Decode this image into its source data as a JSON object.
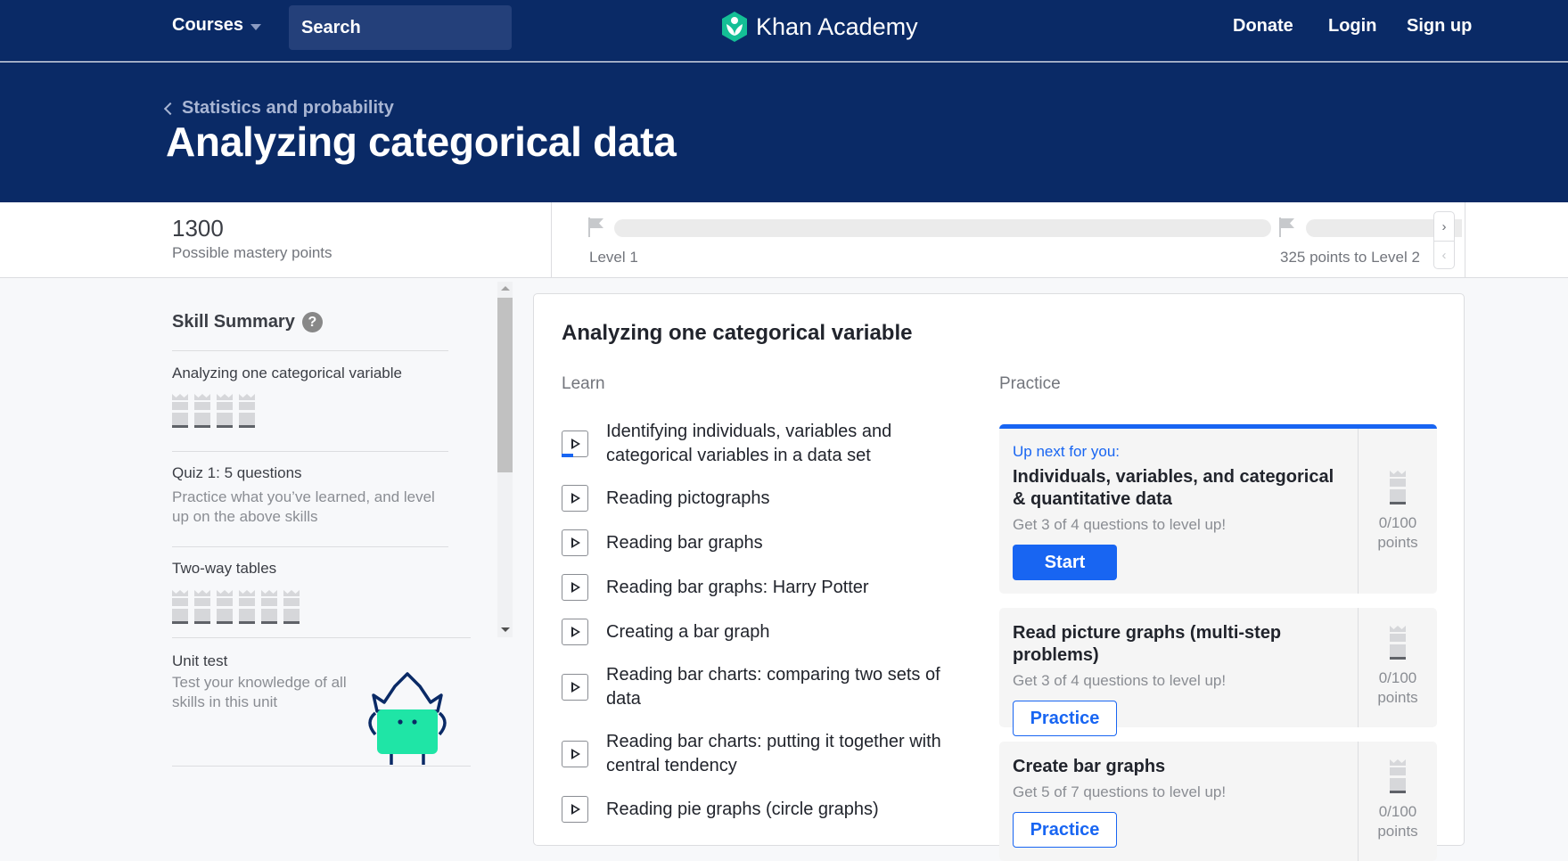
{
  "nav": {
    "courses_label": "Courses",
    "search_placeholder": "Search",
    "logo_text": "Khan Academy",
    "donate": "Donate",
    "login": "Login",
    "signup": "Sign up"
  },
  "hero": {
    "breadcrumb": "Statistics and probability",
    "title": "Analyzing categorical data"
  },
  "stats": {
    "mastery_points": "1300",
    "mastery_label": "Possible mastery points",
    "level_current": "Level 1",
    "level_next_text": "325 points to Level 2",
    "progress_fraction": 0
  },
  "sidebar": {
    "title": "Skill Summary",
    "help_glyph": "?",
    "items": [
      {
        "label": "Analyzing one categorical variable",
        "towers": 4
      },
      {
        "label": "Quiz 1: 5 questions",
        "desc": "Practice what you’ve learned, and level up on the above skills"
      },
      {
        "label": "Two-way tables",
        "towers": 6
      }
    ],
    "unit_test": {
      "title": "Unit test",
      "desc": "Test your knowledge of all skills in this unit"
    }
  },
  "main": {
    "section_title": "Analyzing one categorical variable",
    "learn_label": "Learn",
    "practice_label": "Practice",
    "lessons": [
      {
        "title": "Identifying individuals, variables and categorical variables in a data set",
        "in_progress": true
      },
      {
        "title": "Reading pictographs"
      },
      {
        "title": "Reading bar graphs"
      },
      {
        "title": "Reading bar graphs: Harry Potter"
      },
      {
        "title": "Creating a bar graph"
      },
      {
        "title": "Reading bar charts: comparing two sets of data"
      },
      {
        "title": "Reading bar charts: putting it together with central tendency"
      },
      {
        "title": "Reading pie graphs (circle graphs)"
      }
    ],
    "practice": [
      {
        "upnext": "Up next for you:",
        "title": "Individuals, variables, and categorical & quantitative data",
        "sub": "Get 3 of 4 questions to level up!",
        "button": "Start",
        "points": "0/100",
        "points_unit": "points"
      },
      {
        "title": "Read picture graphs (multi-step problems)",
        "sub": "Get 3 of 4 questions to level up!",
        "button": "Practice",
        "points": "0/100",
        "points_unit": "points"
      },
      {
        "title": "Create bar graphs",
        "sub": "Get 5 of 7 questions to level up!",
        "button": "Practice",
        "points": "0/100",
        "points_unit": "points"
      }
    ]
  },
  "colors": {
    "nav_bg": "#0a2a66",
    "accent_blue": "#1865f2",
    "mascot_green": "#1fe5a6"
  }
}
